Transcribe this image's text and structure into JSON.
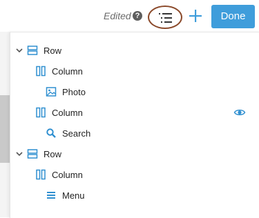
{
  "topbar": {
    "edited_label": "Edited",
    "help_icon_text": "?",
    "done_label": "Done",
    "accent_color": "#3f9ddb",
    "highlight_ring_color": "#8b4a2b"
  },
  "outline": {
    "items": [
      {
        "label": "Row",
        "icon": "row-icon",
        "level": 0,
        "expanded": true
      },
      {
        "label": "Column",
        "icon": "column-icon",
        "level": 1
      },
      {
        "label": "Photo",
        "icon": "photo-icon",
        "level": 2
      },
      {
        "label": "Column",
        "icon": "column-icon",
        "level": 1,
        "trailing_icon": "eye-icon"
      },
      {
        "label": "Search",
        "icon": "search-icon",
        "level": 2
      },
      {
        "label": "Row",
        "icon": "row-icon",
        "level": 0,
        "expanded": true
      },
      {
        "label": "Column",
        "icon": "column-icon",
        "level": 1
      },
      {
        "label": "Menu",
        "icon": "menu-icon",
        "level": 2
      }
    ]
  }
}
